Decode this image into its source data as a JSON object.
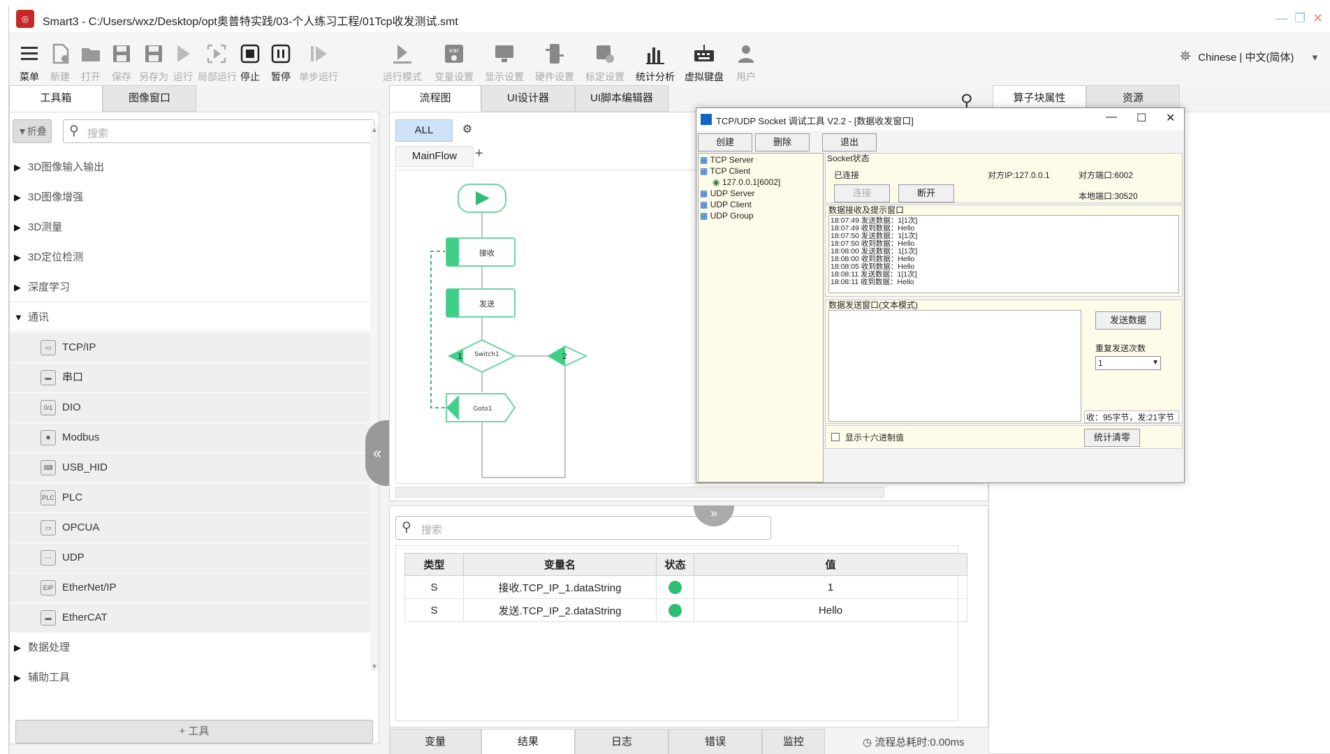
{
  "window": {
    "title": "Smart3 - C:/Users/wxz/Desktop/opt奥普特实践/03-个人练习工程/01Tcp收发测试.smt"
  },
  "toolbar": {
    "items": [
      "菜单",
      "新建",
      "打开",
      "保存",
      "另存为",
      "运行",
      "局部运行",
      "停止",
      "暂停",
      "单步运行",
      "运行模式",
      "变量设置",
      "显示设置",
      "硬件设置",
      "标定设置",
      "统计分析",
      "虚拟键盘",
      "用户"
    ],
    "language": "Chinese | 中文(简体)"
  },
  "left": {
    "tabs": [
      "工具箱",
      "图像窗口"
    ],
    "collapse_label": "折叠",
    "search_placeholder": "搜索",
    "categories_top": [
      "3D图像输入输出",
      "3D图像增强",
      "3D测量",
      "3D定位检测",
      "深度学习",
      "通讯"
    ],
    "comm_items": [
      "TCP/IP",
      "串口",
      "DIO",
      "Modbus",
      "USB_HID",
      "PLC",
      "OPCUA",
      "UDP",
      "EtherNet/IP",
      "EtherCAT"
    ],
    "categories_bottom": [
      "数据处理",
      "辅助工具"
    ],
    "add_tool": "+ 工具"
  },
  "center": {
    "tabs": [
      "流程图",
      "UI设计器",
      "UI脚本编辑器"
    ],
    "filter": "ALL",
    "flow_tab": "MainFlow",
    "nodes": {
      "recv": "接收",
      "send": "发送",
      "switch": "Switch1",
      "goto": "Goto1",
      "one": "1",
      "two": "2"
    }
  },
  "right": {
    "tabs": [
      "算子块属性",
      "资源"
    ]
  },
  "socket_tool": {
    "title": "TCP/UDP Socket 调试工具 V2.2 - [数据收发窗口]",
    "buttons": {
      "create": "创建",
      "delete": "删除",
      "exit": "退出",
      "connect": "连接",
      "disconnect": "断开",
      "send": "发送数据",
      "clear": "统计清零"
    },
    "tree": [
      "TCP Server",
      "TCP Client",
      "127.0.0.1[6002]",
      "UDP Server",
      "UDP Client",
      "UDP Group"
    ],
    "status_group": "Socket状态",
    "connected": "已连接",
    "peer_ip": "对方IP:127.0.0.1",
    "peer_port": "对方端口:6002",
    "local_port": "本地端口:30520",
    "recv_group": "数据接收及提示窗口",
    "log": [
      "18:07:49 发送数据：1[1次]",
      "18:07:49 收到数据：Hello",
      "18:07:50 发送数据：1[1次]",
      "18:07:50 收到数据：Hello",
      "18:08:00 发送数据：1[1次]",
      "18:08:00 收到数据：Hello",
      "18:08:05 收到数据：Hello",
      "18:08:11 发送数据：1[1次]",
      "18:08:11 收到数据：Hello"
    ],
    "send_group": "数据发送窗口(文本模式)",
    "repeat_label": "重复发送次数",
    "repeat_value": "1",
    "stats": "收：95字节，发:21字节",
    "hex_label": "显示十六进制值"
  },
  "results": {
    "search_placeholder": "搜索",
    "columns": [
      "类型",
      "变量名",
      "状态",
      "值"
    ],
    "rows": [
      {
        "type": "S",
        "name": "接收.TCP_IP_1.dataString",
        "value": "1"
      },
      {
        "type": "S",
        "name": "发送.TCP_IP_2.dataString",
        "value": "Hello"
      }
    ],
    "status_color": "#2ebd73"
  },
  "bottom_tabs": [
    "变量",
    "结果",
    "日志",
    "错误",
    "监控"
  ],
  "total_time": "流程总耗时:0.00ms"
}
